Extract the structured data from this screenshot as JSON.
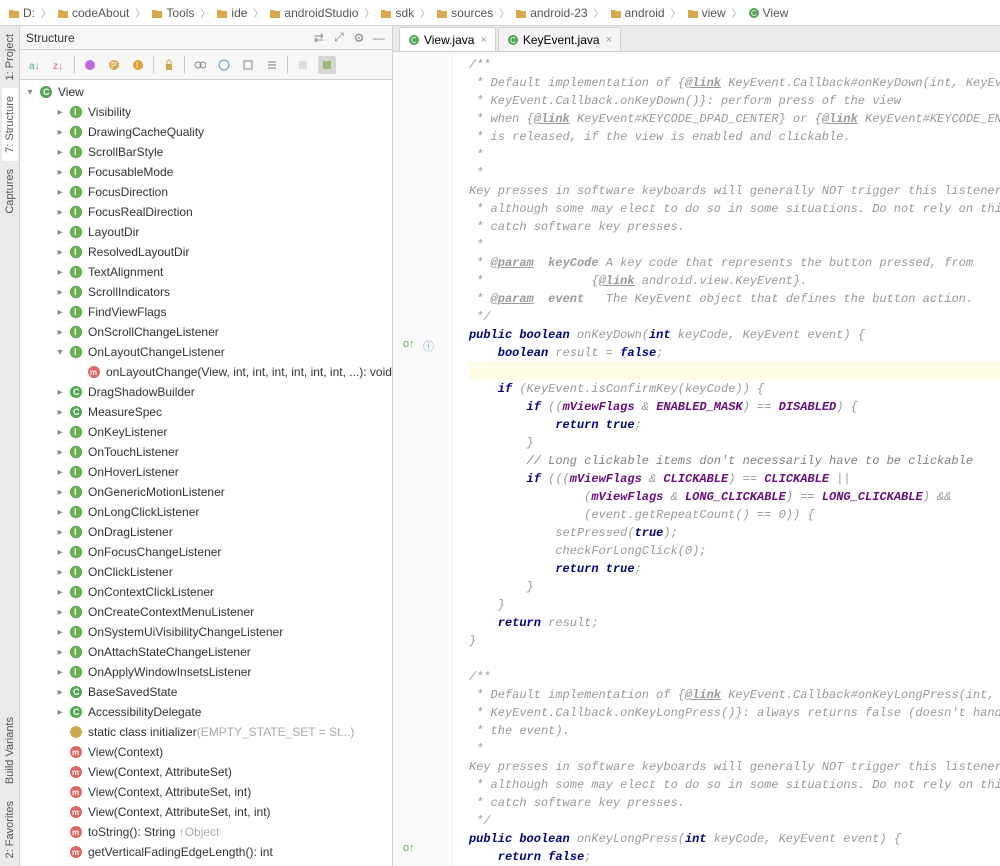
{
  "breadcrumbs": [
    "D:",
    "codeAbout",
    "Tools",
    "ide",
    "androidStudio",
    "sdk",
    "sources",
    "android-23",
    "android",
    "view",
    "View"
  ],
  "panel": {
    "title": "Structure",
    "root": "View"
  },
  "sideTabs": {
    "project": "1: Project",
    "structure": "7: Structure",
    "captures": "Captures",
    "buildVariants": "Build Variants",
    "favorites": "2: Favorites"
  },
  "tabs": [
    {
      "label": "View.java",
      "active": true
    },
    {
      "label": "KeyEvent.java",
      "active": false
    }
  ],
  "tree": {
    "root": {
      "label": "View",
      "icon": "class",
      "depth": 0,
      "expanded": true
    },
    "items": [
      {
        "label": "Visibility",
        "icon": "interface",
        "depth": 1,
        "toggle": "▸"
      },
      {
        "label": "DrawingCacheQuality",
        "icon": "interface",
        "depth": 1,
        "toggle": "▸"
      },
      {
        "label": "ScrollBarStyle",
        "icon": "interface",
        "depth": 1,
        "toggle": "▸"
      },
      {
        "label": "FocusableMode",
        "icon": "interface",
        "depth": 1,
        "toggle": "▸"
      },
      {
        "label": "FocusDirection",
        "icon": "interface",
        "depth": 1,
        "toggle": "▸"
      },
      {
        "label": "FocusRealDirection",
        "icon": "interface",
        "depth": 1,
        "toggle": "▸"
      },
      {
        "label": "LayoutDir",
        "icon": "interface",
        "depth": 1,
        "toggle": "▸"
      },
      {
        "label": "ResolvedLayoutDir",
        "icon": "interface",
        "depth": 1,
        "toggle": "▸"
      },
      {
        "label": "TextAlignment",
        "icon": "interface",
        "depth": 1,
        "toggle": "▸"
      },
      {
        "label": "ScrollIndicators",
        "icon": "interface",
        "depth": 1,
        "toggle": "▸"
      },
      {
        "label": "FindViewFlags",
        "icon": "interface",
        "depth": 1,
        "toggle": "▸"
      },
      {
        "label": "OnScrollChangeListener",
        "icon": "interface",
        "depth": 1,
        "toggle": "▸"
      },
      {
        "label": "OnLayoutChangeListener",
        "icon": "interface",
        "depth": 1,
        "toggle": "▾",
        "expanded": true
      },
      {
        "label": "onLayoutChange(View, int, int, int, int, int, int, ...): void",
        "icon": "method",
        "depth": 2,
        "toggle": " "
      },
      {
        "label": "DragShadowBuilder",
        "icon": "class",
        "depth": 1,
        "toggle": "▸"
      },
      {
        "label": "MeasureSpec",
        "icon": "class",
        "depth": 1,
        "toggle": "▸"
      },
      {
        "label": "OnKeyListener",
        "icon": "interface",
        "depth": 1,
        "toggle": "▸"
      },
      {
        "label": "OnTouchListener",
        "icon": "interface",
        "depth": 1,
        "toggle": "▸"
      },
      {
        "label": "OnHoverListener",
        "icon": "interface",
        "depth": 1,
        "toggle": "▸"
      },
      {
        "label": "OnGenericMotionListener",
        "icon": "interface",
        "depth": 1,
        "toggle": "▸"
      },
      {
        "label": "OnLongClickListener",
        "icon": "interface",
        "depth": 1,
        "toggle": "▸"
      },
      {
        "label": "OnDragListener",
        "icon": "interface",
        "depth": 1,
        "toggle": "▸"
      },
      {
        "label": "OnFocusChangeListener",
        "icon": "interface",
        "depth": 1,
        "toggle": "▸"
      },
      {
        "label": "OnClickListener",
        "icon": "interface",
        "depth": 1,
        "toggle": "▸"
      },
      {
        "label": "OnContextClickListener",
        "icon": "interface",
        "depth": 1,
        "toggle": "▸"
      },
      {
        "label": "OnCreateContextMenuListener",
        "icon": "interface",
        "depth": 1,
        "toggle": "▸"
      },
      {
        "label": "OnSystemUiVisibilityChangeListener",
        "icon": "interface",
        "depth": 1,
        "toggle": "▸"
      },
      {
        "label": "OnAttachStateChangeListener",
        "icon": "interface",
        "depth": 1,
        "toggle": "▸"
      },
      {
        "label": "OnApplyWindowInsetsListener",
        "icon": "interface",
        "depth": 1,
        "toggle": "▸"
      },
      {
        "label": "BaseSavedState",
        "icon": "class",
        "depth": 1,
        "toggle": "▸"
      },
      {
        "label": "AccessibilityDelegate",
        "icon": "class",
        "depth": 1,
        "toggle": "▸"
      },
      {
        "label": "static class initializer",
        "muted": "(EMPTY_STATE_SET = St...)",
        "icon": "enum",
        "depth": 1,
        "toggle": " "
      },
      {
        "label": "View(Context)",
        "icon": "method",
        "depth": 1,
        "toggle": " "
      },
      {
        "label": "View(Context, AttributeSet)",
        "icon": "method",
        "depth": 1,
        "toggle": " "
      },
      {
        "label": "View(Context, AttributeSet, int)",
        "icon": "method",
        "depth": 1,
        "toggle": " "
      },
      {
        "label": "View(Context, AttributeSet, int, int)",
        "icon": "method",
        "depth": 1,
        "toggle": " "
      },
      {
        "label": "toString(): String",
        "muted": " ↑Object",
        "icon": "method",
        "depth": 1,
        "toggle": " "
      },
      {
        "label": "getVerticalFadingEdgeLength(): int",
        "icon": "method",
        "depth": 1,
        "toggle": " "
      }
    ]
  },
  "code": {
    "l1": "/**",
    "l2": " * Default implementation of {",
    "l2b": "@link",
    "l2c": " KeyEvent.Callback#onKeyDown(int, KeyEvent)",
    "l3": " * KeyEvent.Callback.onKeyDown()}: perform press of the view",
    "l4": " * when {",
    "l4b": "@link",
    "l4c": " KeyEvent#KEYCODE_DPAD_CENTER} or {",
    "l4d": "@link",
    "l4e": " KeyEvent#KEYCODE_ENTER}",
    "l5": " * is released, if the view is enabled and clickable.",
    "l6": " *",
    "l7": " * <p>Key presses in software keyboards will generally NOT trigger this listener,",
    "l8": " * although some may elect to do so in some situations. Do not rely on this to",
    "l9": " * catch software key presses.",
    "l10": " *",
    "l11": " * ",
    "l11b": "@param",
    "l11c": " keyCode",
    " l11d": " A key code that represents the button pressed, from",
    "l12": " *               {",
    "l12b": "@link",
    "l12c": " android.view.KeyEvent}.",
    "l13": " * ",
    "l13b": "@param",
    "l13c": " event",
    "l13d": "   The KeyEvent object that defines the button action.",
    "l14": " */",
    "sig": "public boolean ",
    "sigm": "onKeyDown",
    "sigp": "(int keyCode, KeyEvent event) {",
    "r1": "    boolean ",
    "r1v": "result = ",
    "r1f": "false",
    "r3": "    if (KeyEvent.",
    "r3m": "isConfirmKey",
    "r3p": "(keyCode)) {",
    "r4": "        if ((",
    "r4a": "mViewFlags",
    "r4b": " & ",
    "r4c": "ENABLED_MASK",
    "r4d": ") == ",
    "r4e": "DISABLED",
    "r4f": ") {",
    "r5": "            return true",
    "r6": "        }",
    "r7": "        // Long clickable items don't necessarily have to be clickable",
    "r8": "        if (((",
    "r8a": "mViewFlags",
    "r8b": " & ",
    "r8c": "CLICKABLE",
    "r8d": ") == ",
    "r8e": "CLICKABLE",
    "r8f": " ||",
    "r9": "                (",
    "r9a": "mViewFlags",
    "r9b": " & ",
    "r9c": "LONG_CLICKABLE",
    "r9d": ") == ",
    "r9e": "LONG_CLICKABLE",
    "r9f": ") &&",
    "r10": "                (event.getRepeatCount() == 0)) {",
    "r11": "            setPressed(",
    "r11t": "true",
    "r11e": ");",
    "r12": "            checkForLongClick(0);",
    "r13": "            return true",
    "r14": "        }",
    "r15": "    }",
    "r16": "    return ",
    "r16v": "result",
    "r17": "}",
    "c2l1": "/**",
    "c2l2": " * Default implementation of {",
    "c2l2b": "@link",
    "c2l2c": " KeyEvent.Callback#onKeyLongPress(int, KeyEvent",
    "c2l3": " * KeyEvent.Callback.onKeyLongPress()}: always returns false (doesn't handle",
    "c2l4": " * the event).",
    "c2l5": " * <p>Key presses in software keyboards will generally NOT trigger this listener,",
    "c2l6": " * although some may elect to do so in some situations. Do not rely on this to",
    "c2l7": " * catch software key presses.",
    "c2l8": " */",
    "sig2": "public boolean ",
    "sig2m": "onKeyLongPress",
    "sig2p": "(int keyCode, KeyEvent event) {",
    "rf": "    return false"
  }
}
